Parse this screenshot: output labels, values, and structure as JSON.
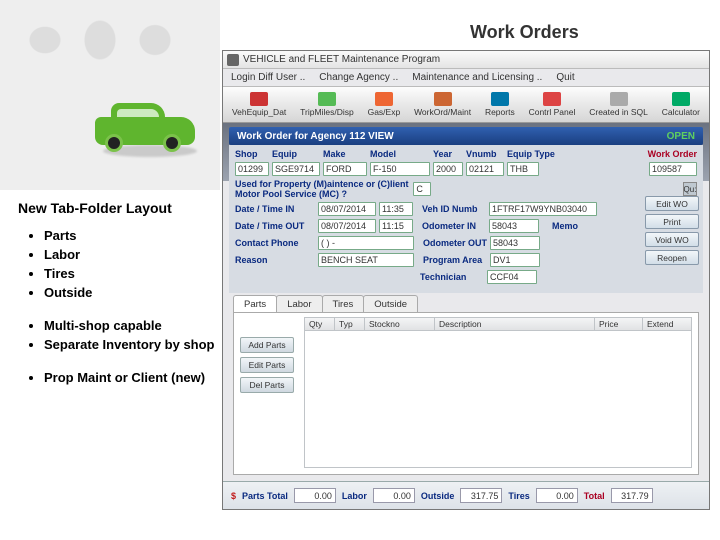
{
  "slide": {
    "title": "Work Orders"
  },
  "side": {
    "heading": "New Tab-Folder Layout",
    "tabs": [
      "Parts",
      "Labor",
      "Tires",
      "Outside"
    ],
    "cap": [
      "Multi-shop capable",
      "Separate Inventory by shop"
    ],
    "new": [
      "Prop Maint or Client (new)"
    ]
  },
  "app_title": "VEHICLE and FLEET Maintenance Program",
  "menu": [
    "Login Diff User ..",
    "Change Agency ..",
    "Maintenance and Licensing ..",
    "Quit"
  ],
  "toolbar": [
    {
      "label": "VehEquip_Dat",
      "color": "#c33"
    },
    {
      "label": "TripMiles/Disp",
      "color": "#5b5"
    },
    {
      "label": "Gas/Exp",
      "color": "#e63"
    },
    {
      "label": "WorkOrd/Maint",
      "color": "#c63"
    },
    {
      "label": "Reports",
      "color": "#07a"
    },
    {
      "label": "Contrl Panel",
      "color": "#d44"
    },
    {
      "label": "Created in SQL",
      "color": "#aaa"
    },
    {
      "label": "Calculator",
      "color": "#0a6"
    }
  ],
  "wohead": {
    "left": "Work Order for Agency 112   VIEW",
    "right": "OPEN"
  },
  "band_labels": {
    "shop": "Shop",
    "equip": "Equip",
    "make": "Make",
    "model": "Model",
    "year": "Year",
    "vnumb": "Vnumb",
    "etype": "Equip Type",
    "wo": "Work Order",
    "used": "Used for Property (M)aintence or (C)lient Motor Pool Service (MC)  ?",
    "dti": "Date / Time IN",
    "dto": "Date / Time OUT",
    "cp": "Contact Phone",
    "reason": "Reason",
    "vin": "Veh ID Numb",
    "oin": "Odometer IN",
    "oout": "Odometer OUT",
    "pa": "Program Area",
    "tech": "Technician",
    "memo": "Memo"
  },
  "band_values": {
    "shop": "01299",
    "equip": "SGE9714",
    "make": "FORD",
    "model": "F-150",
    "year": "2000",
    "vnumb": "02121",
    "etype": "THB",
    "wo": "109587",
    "mc": "C",
    "date_in": "08/07/2014",
    "time_in": "11:35",
    "date_out": "08/07/2014",
    "time_out": "11:15",
    "phone": "( ) -",
    "reason": "BENCH SEAT",
    "vin": "1FTRF17W9YNB03040",
    "odo_in": "58043",
    "odo_out": "58043",
    "pa": "DV1",
    "tech": "CCF04"
  },
  "sidebtns": [
    "Edit WO",
    "Print",
    "Void WO",
    "Reopen"
  ],
  "qbtn": "Qu:",
  "tabs": [
    {
      "label": "Parts",
      "active": true
    },
    {
      "label": "Labor",
      "active": false
    },
    {
      "label": "Tires",
      "active": false
    },
    {
      "label": "Outside",
      "active": false
    }
  ],
  "grid_cols": [
    "Qty",
    "Typ",
    "Stockno",
    "Description",
    "Price",
    "Extend"
  ],
  "grid_widths": [
    "30px",
    "30px",
    "70px",
    "auto",
    "48px",
    "48px"
  ],
  "parts_btns": [
    "Add Parts",
    "Edit Parts",
    "Del Parts"
  ],
  "totals": {
    "curr": "$",
    "parts_l": "Parts Total",
    "parts": "0.00",
    "labor_l": "Labor",
    "labor": "0.00",
    "out_l": "Outside",
    "out": "317.75",
    "tires_l": "Tires",
    "tires": "0.00",
    "total_l": "Total",
    "total": "317.79"
  }
}
